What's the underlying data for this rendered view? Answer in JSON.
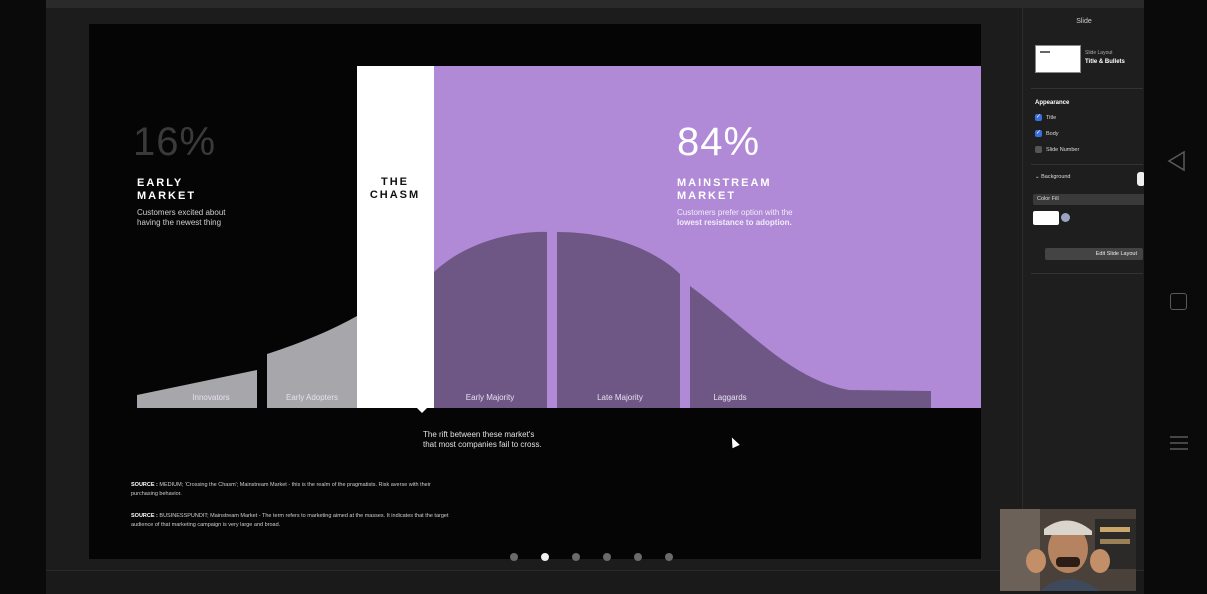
{
  "slide": {
    "early_percent": "16%",
    "early_heading": [
      "EARLY",
      "MARKET"
    ],
    "early_sub": [
      "Customers excited about",
      "having the newest thing"
    ],
    "chasm_heading": [
      "THE",
      "CHASM"
    ],
    "main_percent": "84%",
    "main_heading": [
      "MAINSTREAM",
      "MARKET"
    ],
    "main_sub": [
      "Customers prefer option with the",
      "lowest resistance to adoption."
    ],
    "segments": [
      "Innovators",
      "Early Adopters",
      "Early Majority",
      "Late Majority",
      "Laggards"
    ],
    "rift": [
      "The rift between these market's",
      "that most companies fail to cross."
    ],
    "sources": [
      {
        "label": "SOURCE :",
        "line1": " MEDIUM; 'Crossing the Chasm'; Mainstream Market - this is the realm of the pragmatists. Risk averse with their",
        "line2": "purchasing behavior."
      },
      {
        "label": "SOURCE :",
        "line1": " BUSINESSPUNDIT; Mainstream Market - The term refers to marketing aimed at the masses. It indicates that the target",
        "line2": "audience of that marketing campaign is very large and broad."
      }
    ],
    "colors": {
      "purple": "#b08ad6",
      "chasm": "#ffffff",
      "early_curve": "#a7a6ab",
      "main_curve": "#6e5785"
    }
  },
  "pagination": {
    "count": 6,
    "active_index": 1
  },
  "inspector": {
    "title": "Slide",
    "slide_layout_label": "Slide Layout",
    "slide_layout_name": "Title & Bullets",
    "appearance": "Appearance",
    "checkboxes": [
      {
        "label": "Title",
        "checked": true
      },
      {
        "label": "Body",
        "checked": true
      },
      {
        "label": "Slide Number",
        "checked": false
      }
    ],
    "background_label": "Background",
    "color_fill": "Color Fill",
    "edit_layout": "Edit Slide Layout"
  }
}
